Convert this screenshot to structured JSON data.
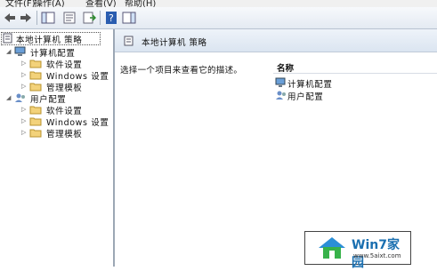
{
  "menu": {
    "file": "文件(F)",
    "action": "操作(A)",
    "view": "查看(V)",
    "help": "帮助(H)"
  },
  "tree": {
    "root": "本地计算机 策略",
    "computer": "计算机配置",
    "user": "用户配置",
    "children": [
      "软件设置",
      "Windows 设置",
      "管理模板"
    ]
  },
  "pane": {
    "title": "本地计算机 策略",
    "description": "选择一个项目来查看它的描述。",
    "column_name": "名称",
    "items": [
      "计算机配置",
      "用户配置"
    ]
  },
  "watermark": {
    "brand": "Win7家园",
    "url": "www.5aixt.com"
  }
}
